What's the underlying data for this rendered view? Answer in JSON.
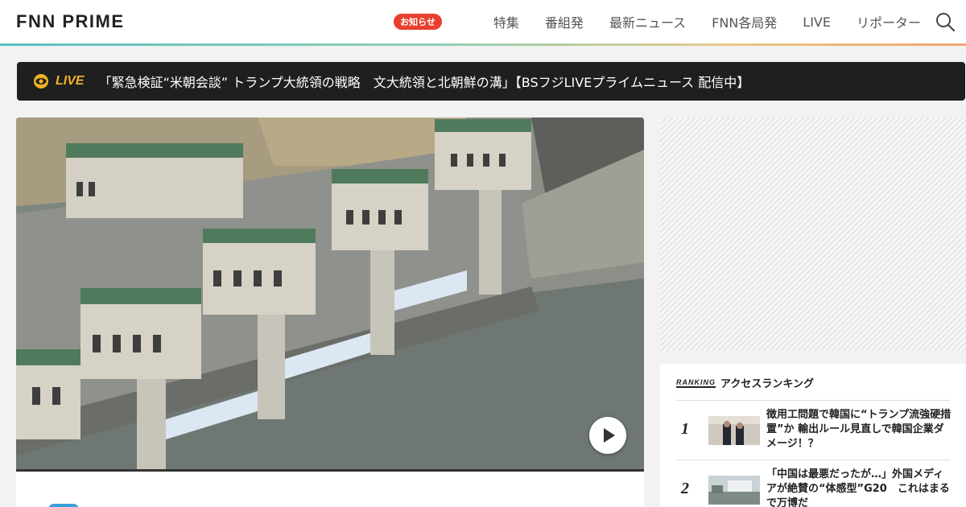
{
  "header": {
    "logo": "FNN PRIME",
    "notice_badge": "お知らせ",
    "nav": [
      "特集",
      "番組発",
      "最新ニュース",
      "FNN各局発",
      "LIVE",
      "リポーター"
    ]
  },
  "live": {
    "label": "LIVE",
    "text": "「緊急検証“米朝会談” トランプ大統領の戦略　文大統領と北朝鮮の溝」【BSフジLIVEプライムニュース 配信中】"
  },
  "ranking": {
    "logo": "RANKING",
    "title": "アクセスランキング",
    "items": [
      {
        "rank": "1",
        "title": "徴用工問題で韓国に“トランプ流強硬措置”か 輸出ルール見直しで韓国企業ダメージ！？"
      },
      {
        "rank": "2",
        "title": "「中国は最悪だったが…」外国メディアが絶賛の“体感型”G20　これはまるで万博だ"
      }
    ]
  },
  "colors": {
    "accent": "#e8402d",
    "live": "#f0b323"
  }
}
